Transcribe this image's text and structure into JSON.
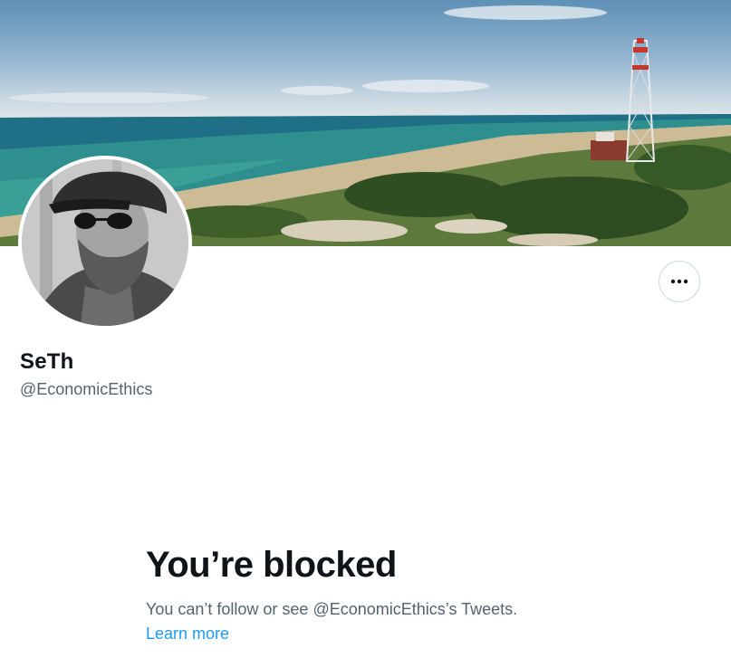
{
  "profile": {
    "display_name": "SeTh",
    "handle": "@EconomicEthics"
  },
  "actions": {
    "more_icon": "more-horizontal-icon"
  },
  "blocked": {
    "title": "You’re blocked",
    "description": "You can’t follow or see @EconomicEthics’s Tweets.",
    "learn_more": "Learn more"
  },
  "colors": {
    "link": "#1d9bf0",
    "secondary_text": "#536471",
    "primary_text": "#0f1419",
    "border": "#cfd9de"
  }
}
